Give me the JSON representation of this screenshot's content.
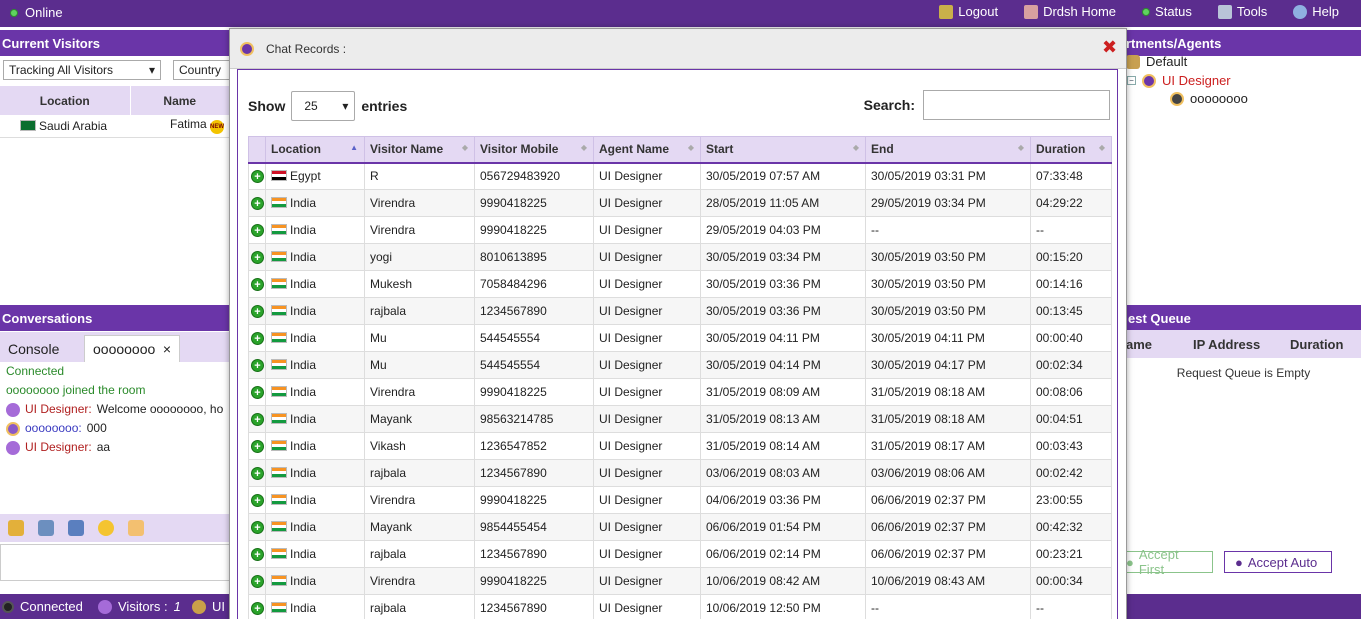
{
  "top_bar": {
    "status": "Online",
    "nav": [
      {
        "label": "Logout",
        "icon": "logout-icon"
      },
      {
        "label": "Drdsh Home",
        "icon": "home-icon"
      },
      {
        "label": "Status",
        "icon": "status-dot-icon"
      },
      {
        "label": "Tools",
        "icon": "wrench-icon"
      },
      {
        "label": "Help",
        "icon": "help-icon"
      }
    ]
  },
  "current_visitors": {
    "title": "Current Visitors",
    "tracking_select": "Tracking All Visitors",
    "country_select": "Country",
    "columns": [
      "Location",
      "Name"
    ],
    "rows": [
      {
        "location": "Saudi Arabia",
        "name": "Fatima"
      }
    ]
  },
  "departments": {
    "title": "rtments/Agents",
    "root": "Default",
    "agent": "UI Designer",
    "visitor": "oooooooo"
  },
  "conversations": {
    "title": "Conversations",
    "tab_console": "Console",
    "tab_user": "oooooooo",
    "tab_close": "×",
    "lines": {
      "connected": "Connected",
      "joined": "oooooooo joined the room",
      "m1_name": "UI Designer:",
      "m1_text": "Welcome oooooooo, ho",
      "m2_name": "oooooooo:",
      "m2_text": "000",
      "m3_name": "UI Designer:",
      "m3_text": "aa"
    }
  },
  "request_queue": {
    "title": "est Queue",
    "col_name": "ame",
    "col_ip": "IP Address",
    "col_duration": "Duration",
    "empty": "Request Queue is Empty",
    "accept_first": "Accept First",
    "accept_auto": "Accept Auto"
  },
  "bottom_bar": {
    "connected": "Connected",
    "visitors_label": "Visitors : ",
    "visitors_count": "1",
    "agent": "UI D"
  },
  "modal": {
    "title": "Chat Records :",
    "close": "✖",
    "show_label": "Show",
    "show_value": "25",
    "entries_label": "entries",
    "search_label": "Search:",
    "columns": [
      "Location",
      "Visitor Name",
      "Visitor Mobile",
      "Agent Name",
      "Start",
      "End",
      "Duration"
    ],
    "rows": [
      [
        "Egypt",
        "R",
        "056729483920",
        "UI Designer",
        "30/05/2019 07:57 AM",
        "30/05/2019 03:31 PM",
        "07:33:48"
      ],
      [
        "India",
        "Virendra",
        "9990418225",
        "UI Designer",
        "28/05/2019 11:05 AM",
        "29/05/2019 03:34 PM",
        "04:29:22"
      ],
      [
        "India",
        "Virendra",
        "9990418225",
        "UI Designer",
        "29/05/2019 04:03 PM",
        "--",
        "--"
      ],
      [
        "India",
        "yogi",
        "8010613895",
        "UI Designer",
        "30/05/2019 03:34 PM",
        "30/05/2019 03:50 PM",
        "00:15:20"
      ],
      [
        "India",
        "Mukesh",
        "7058484296",
        "UI Designer",
        "30/05/2019 03:36 PM",
        "30/05/2019 03:50 PM",
        "00:14:16"
      ],
      [
        "India",
        "rajbala",
        "1234567890",
        "UI Designer",
        "30/05/2019 03:36 PM",
        "30/05/2019 03:50 PM",
        "00:13:45"
      ],
      [
        "India",
        "Mu",
        "544545554",
        "UI Designer",
        "30/05/2019 04:11 PM",
        "30/05/2019 04:11 PM",
        "00:00:40"
      ],
      [
        "India",
        "Mu",
        "544545554",
        "UI Designer",
        "30/05/2019 04:14 PM",
        "30/05/2019 04:17 PM",
        "00:02:34"
      ],
      [
        "India",
        "Virendra",
        "9990418225",
        "UI Designer",
        "31/05/2019 08:09 AM",
        "31/05/2019 08:18 AM",
        "00:08:06"
      ],
      [
        "India",
        "Mayank",
        "98563214785",
        "UI Designer",
        "31/05/2019 08:13 AM",
        "31/05/2019 08:18 AM",
        "00:04:51"
      ],
      [
        "India",
        "Vikash",
        "1236547852",
        "UI Designer",
        "31/05/2019 08:14 AM",
        "31/05/2019 08:17 AM",
        "00:03:43"
      ],
      [
        "India",
        "rajbala",
        "1234567890",
        "UI Designer",
        "03/06/2019 08:03 AM",
        "03/06/2019 08:06 AM",
        "00:02:42"
      ],
      [
        "India",
        "Virendra",
        "9990418225",
        "UI Designer",
        "04/06/2019 03:36 PM",
        "06/06/2019 02:37 PM",
        "23:00:55"
      ],
      [
        "India",
        "Mayank",
        "9854455454",
        "UI Designer",
        "06/06/2019 01:54 PM",
        "06/06/2019 02:37 PM",
        "00:42:32"
      ],
      [
        "India",
        "rajbala",
        "1234567890",
        "UI Designer",
        "06/06/2019 02:14 PM",
        "06/06/2019 02:37 PM",
        "00:23:21"
      ],
      [
        "India",
        "Virendra",
        "9990418225",
        "UI Designer",
        "10/06/2019 08:42 AM",
        "10/06/2019 08:43 AM",
        "00:00:34"
      ],
      [
        "India",
        "rajbala",
        "1234567890",
        "UI Designer",
        "10/06/2019 12:50 PM",
        "--",
        "--"
      ]
    ]
  },
  "colors": {
    "brand_purple": "#5b2d8e",
    "header_lilac": "#e4d9f3",
    "agent_red": "#cc1f1f",
    "ok_green": "#2a8a2a"
  }
}
